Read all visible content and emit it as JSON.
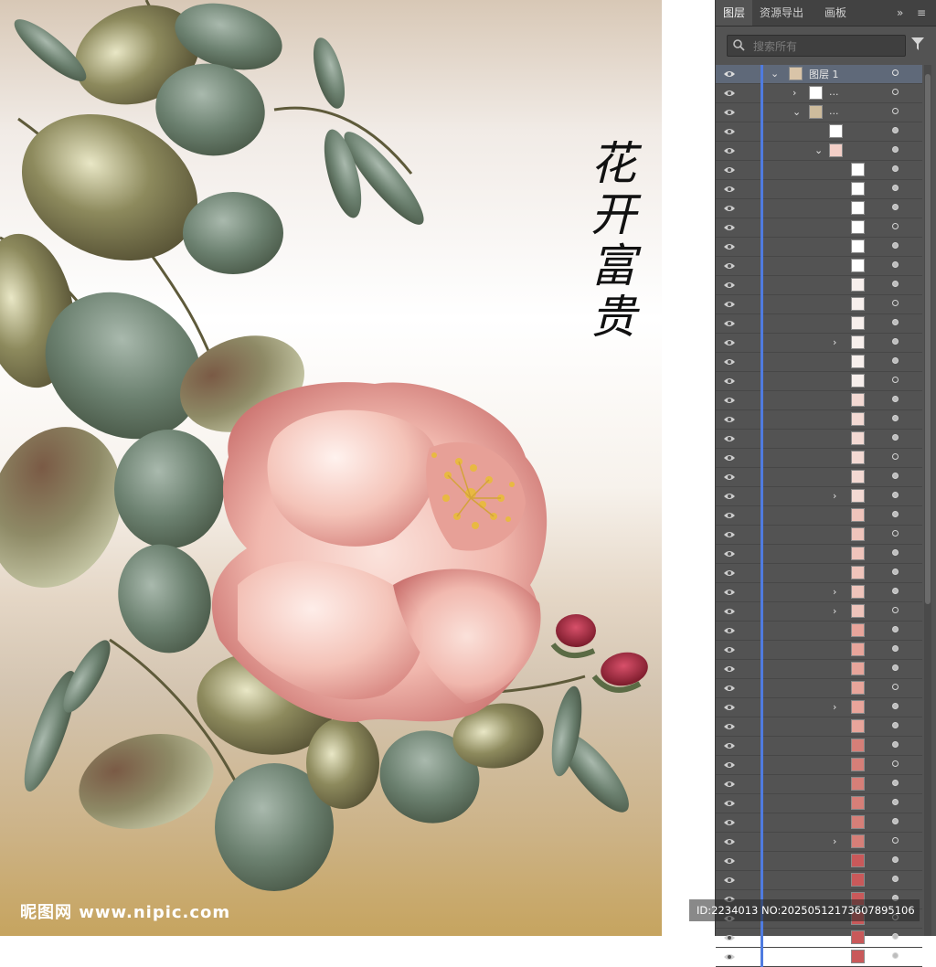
{
  "artwork": {
    "title": "花开富贵"
  },
  "watermark": {
    "site": "昵图网 www.nipic.com",
    "id": "ID:2234013 NO:20250512173607895106"
  },
  "panel": {
    "tabs": [
      {
        "label": "图层"
      },
      {
        "label": "资源导出"
      },
      {
        "label": "画板"
      }
    ],
    "tab_controls": {
      "expand": "»",
      "menu": "≡"
    },
    "search": {
      "placeholder": "搜索所有"
    },
    "layers": [
      {
        "name": "图层 1"
      },
      {
        "name": "..."
      },
      {
        "name": "..."
      }
    ],
    "colors": {
      "selection": "#5f6979",
      "accent_bar": "#4f7be0",
      "panel_bg": "#535353"
    }
  }
}
